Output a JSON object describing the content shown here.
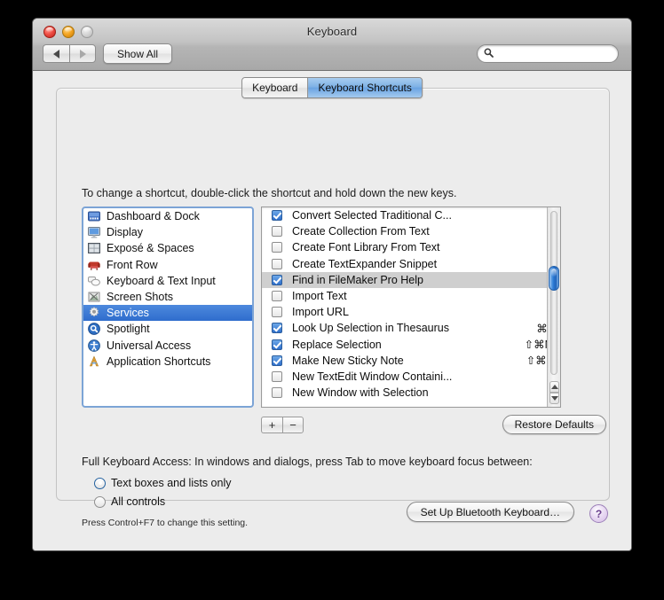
{
  "window": {
    "title": "Keyboard",
    "traffic_lights": [
      "close",
      "minimize",
      "zoom"
    ]
  },
  "toolbar": {
    "back_label": "◀",
    "forward_label": "▶",
    "show_all_label": "Show All",
    "search_value": "",
    "search_placeholder": ""
  },
  "tabs": [
    {
      "label": "Keyboard",
      "selected": false
    },
    {
      "label": "Keyboard Shortcuts",
      "selected": true
    }
  ],
  "instruction": "To change a shortcut, double-click the shortcut and hold down the new keys.",
  "categories": [
    {
      "label": "Dashboard & Dock",
      "icon": "dashboard-dock-icon",
      "selected": false
    },
    {
      "label": "Display",
      "icon": "display-icon",
      "selected": false
    },
    {
      "label": "Exposé & Spaces",
      "icon": "expose-spaces-icon",
      "selected": false
    },
    {
      "label": "Front Row",
      "icon": "front-row-icon",
      "selected": false
    },
    {
      "label": "Keyboard & Text Input",
      "icon": "keyboard-text-input-icon",
      "selected": false
    },
    {
      "label": "Screen Shots",
      "icon": "screen-shots-icon",
      "selected": false
    },
    {
      "label": "Services",
      "icon": "services-gear-icon",
      "selected": true
    },
    {
      "label": "Spotlight",
      "icon": "spotlight-icon",
      "selected": false
    },
    {
      "label": "Universal Access",
      "icon": "universal-access-icon",
      "selected": false
    },
    {
      "label": "Application Shortcuts",
      "icon": "application-shortcuts-icon",
      "selected": false
    }
  ],
  "shortcuts": [
    {
      "name": "Convert Selected Traditional C...",
      "key": "",
      "checked": true,
      "selected": false
    },
    {
      "name": "Create Collection From Text",
      "key": "",
      "checked": false,
      "selected": false
    },
    {
      "name": "Create Font Library From Text",
      "key": "",
      "checked": false,
      "selected": false
    },
    {
      "name": "Create TextExpander Snippet",
      "key": "",
      "checked": false,
      "selected": false
    },
    {
      "name": "Find in FileMaker Pro Help",
      "key": "",
      "checked": true,
      "selected": true
    },
    {
      "name": "Import Text",
      "key": "",
      "checked": false,
      "selected": false
    },
    {
      "name": "Import URL",
      "key": "",
      "checked": false,
      "selected": false
    },
    {
      "name": "Look Up Selection in Thesaurus",
      "key": "⌘<",
      "checked": true,
      "selected": false
    },
    {
      "name": "Replace Selection",
      "key": "⇧⌘M",
      "checked": true,
      "selected": false
    },
    {
      "name": "Make New Sticky Note",
      "key": "⇧⌘Y",
      "checked": true,
      "selected": false
    },
    {
      "name": "New TextEdit Window Containi...",
      "key": "",
      "checked": false,
      "selected": false
    },
    {
      "name": "New Window with Selection",
      "key": "",
      "checked": false,
      "selected": false
    }
  ],
  "list_controls": {
    "add_label": "+",
    "remove_label": "−",
    "restore_defaults_label": "Restore Defaults"
  },
  "full_keyboard_access": {
    "label": "Full Keyboard Access: In windows and dialogs, press Tab to move keyboard focus between:",
    "options": [
      {
        "label": "Text boxes and lists only",
        "selected": true
      },
      {
        "label": "All controls",
        "selected": false
      }
    ],
    "note": "Press Control+F7 to change this setting."
  },
  "footer": {
    "bluetooth_label": "Set Up Bluetooth Keyboard…",
    "help_label": "?"
  },
  "colors": {
    "selection_blue": "#3875d7",
    "inactive_selection_gray": "#cfcfcf",
    "tab_selected_blue": "#7fb2e6",
    "window_background": "#ececec",
    "scroll_thumb_blue": "#2f7fd8"
  }
}
